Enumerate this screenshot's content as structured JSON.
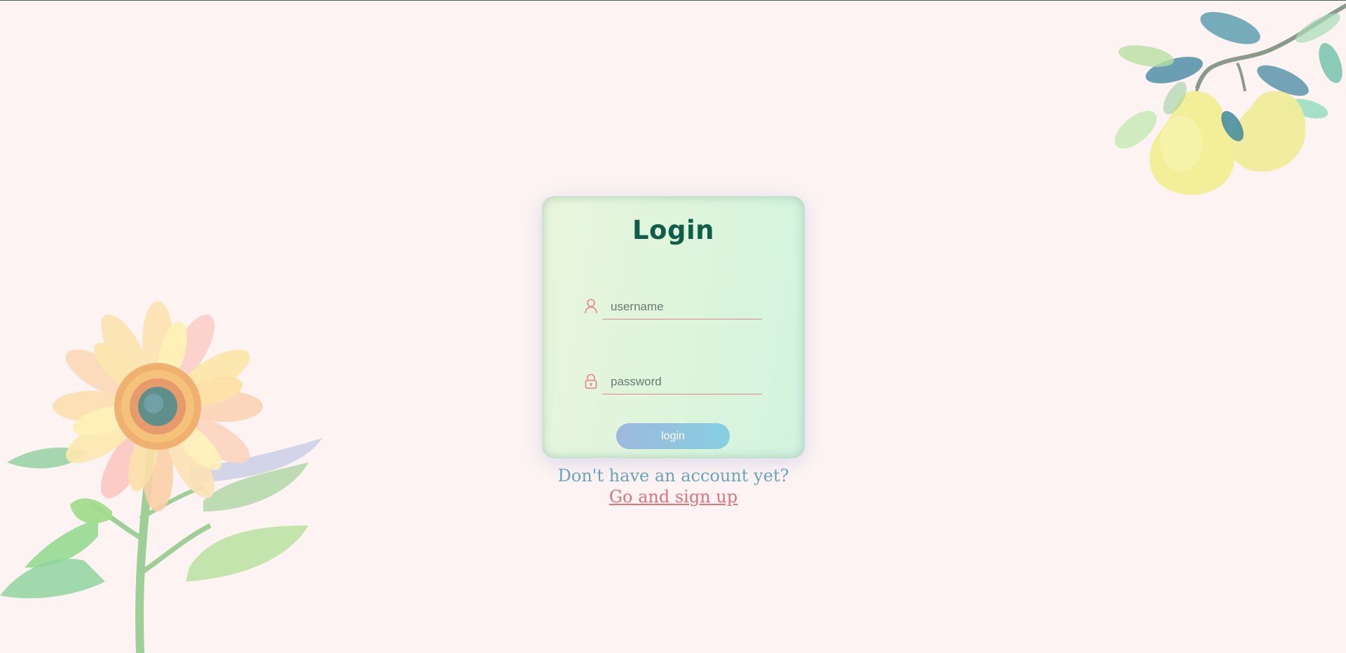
{
  "login": {
    "title": "Login",
    "username_placeholder": "username",
    "password_placeholder": "password",
    "button_label": "login"
  },
  "signup": {
    "prompt": "Don't have an account yet?",
    "link_label": "Go and sign up"
  },
  "icons": {
    "username": "user-icon",
    "password": "lock-icon"
  },
  "colors": {
    "background": "#fcf3f2",
    "title": "#0f5e4c",
    "accent_underline": "#e3858a",
    "prompt_text": "#6aa3bf",
    "link_text": "#df7379"
  }
}
